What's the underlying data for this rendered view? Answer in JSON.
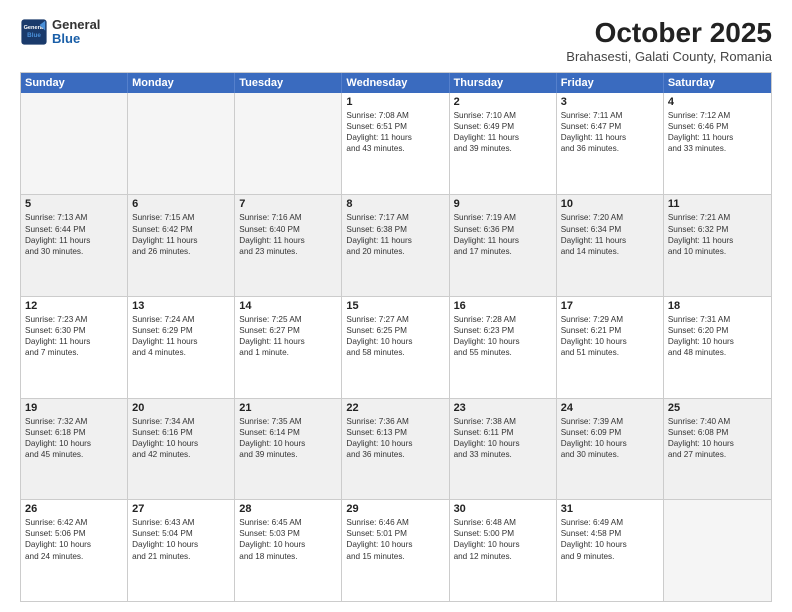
{
  "header": {
    "logo_general": "General",
    "logo_blue": "Blue",
    "title": "October 2025",
    "subtitle": "Brahasesti, Galati County, Romania"
  },
  "days_of_week": [
    "Sunday",
    "Monday",
    "Tuesday",
    "Wednesday",
    "Thursday",
    "Friday",
    "Saturday"
  ],
  "weeks": [
    [
      {
        "day": "",
        "empty": true
      },
      {
        "day": "",
        "empty": true
      },
      {
        "day": "",
        "empty": true
      },
      {
        "day": "1",
        "lines": [
          "Sunrise: 7:08 AM",
          "Sunset: 6:51 PM",
          "Daylight: 11 hours",
          "and 43 minutes."
        ]
      },
      {
        "day": "2",
        "lines": [
          "Sunrise: 7:10 AM",
          "Sunset: 6:49 PM",
          "Daylight: 11 hours",
          "and 39 minutes."
        ]
      },
      {
        "day": "3",
        "lines": [
          "Sunrise: 7:11 AM",
          "Sunset: 6:47 PM",
          "Daylight: 11 hours",
          "and 36 minutes."
        ]
      },
      {
        "day": "4",
        "lines": [
          "Sunrise: 7:12 AM",
          "Sunset: 6:46 PM",
          "Daylight: 11 hours",
          "and 33 minutes."
        ]
      }
    ],
    [
      {
        "day": "5",
        "lines": [
          "Sunrise: 7:13 AM",
          "Sunset: 6:44 PM",
          "Daylight: 11 hours",
          "and 30 minutes."
        ]
      },
      {
        "day": "6",
        "lines": [
          "Sunrise: 7:15 AM",
          "Sunset: 6:42 PM",
          "Daylight: 11 hours",
          "and 26 minutes."
        ]
      },
      {
        "day": "7",
        "lines": [
          "Sunrise: 7:16 AM",
          "Sunset: 6:40 PM",
          "Daylight: 11 hours",
          "and 23 minutes."
        ]
      },
      {
        "day": "8",
        "lines": [
          "Sunrise: 7:17 AM",
          "Sunset: 6:38 PM",
          "Daylight: 11 hours",
          "and 20 minutes."
        ]
      },
      {
        "day": "9",
        "lines": [
          "Sunrise: 7:19 AM",
          "Sunset: 6:36 PM",
          "Daylight: 11 hours",
          "and 17 minutes."
        ]
      },
      {
        "day": "10",
        "lines": [
          "Sunrise: 7:20 AM",
          "Sunset: 6:34 PM",
          "Daylight: 11 hours",
          "and 14 minutes."
        ]
      },
      {
        "day": "11",
        "lines": [
          "Sunrise: 7:21 AM",
          "Sunset: 6:32 PM",
          "Daylight: 11 hours",
          "and 10 minutes."
        ]
      }
    ],
    [
      {
        "day": "12",
        "lines": [
          "Sunrise: 7:23 AM",
          "Sunset: 6:30 PM",
          "Daylight: 11 hours",
          "and 7 minutes."
        ]
      },
      {
        "day": "13",
        "lines": [
          "Sunrise: 7:24 AM",
          "Sunset: 6:29 PM",
          "Daylight: 11 hours",
          "and 4 minutes."
        ]
      },
      {
        "day": "14",
        "lines": [
          "Sunrise: 7:25 AM",
          "Sunset: 6:27 PM",
          "Daylight: 11 hours",
          "and 1 minute."
        ]
      },
      {
        "day": "15",
        "lines": [
          "Sunrise: 7:27 AM",
          "Sunset: 6:25 PM",
          "Daylight: 10 hours",
          "and 58 minutes."
        ]
      },
      {
        "day": "16",
        "lines": [
          "Sunrise: 7:28 AM",
          "Sunset: 6:23 PM",
          "Daylight: 10 hours",
          "and 55 minutes."
        ]
      },
      {
        "day": "17",
        "lines": [
          "Sunrise: 7:29 AM",
          "Sunset: 6:21 PM",
          "Daylight: 10 hours",
          "and 51 minutes."
        ]
      },
      {
        "day": "18",
        "lines": [
          "Sunrise: 7:31 AM",
          "Sunset: 6:20 PM",
          "Daylight: 10 hours",
          "and 48 minutes."
        ]
      }
    ],
    [
      {
        "day": "19",
        "lines": [
          "Sunrise: 7:32 AM",
          "Sunset: 6:18 PM",
          "Daylight: 10 hours",
          "and 45 minutes."
        ]
      },
      {
        "day": "20",
        "lines": [
          "Sunrise: 7:34 AM",
          "Sunset: 6:16 PM",
          "Daylight: 10 hours",
          "and 42 minutes."
        ]
      },
      {
        "day": "21",
        "lines": [
          "Sunrise: 7:35 AM",
          "Sunset: 6:14 PM",
          "Daylight: 10 hours",
          "and 39 minutes."
        ]
      },
      {
        "day": "22",
        "lines": [
          "Sunrise: 7:36 AM",
          "Sunset: 6:13 PM",
          "Daylight: 10 hours",
          "and 36 minutes."
        ]
      },
      {
        "day": "23",
        "lines": [
          "Sunrise: 7:38 AM",
          "Sunset: 6:11 PM",
          "Daylight: 10 hours",
          "and 33 minutes."
        ]
      },
      {
        "day": "24",
        "lines": [
          "Sunrise: 7:39 AM",
          "Sunset: 6:09 PM",
          "Daylight: 10 hours",
          "and 30 minutes."
        ]
      },
      {
        "day": "25",
        "lines": [
          "Sunrise: 7:40 AM",
          "Sunset: 6:08 PM",
          "Daylight: 10 hours",
          "and 27 minutes."
        ]
      }
    ],
    [
      {
        "day": "26",
        "lines": [
          "Sunrise: 6:42 AM",
          "Sunset: 5:06 PM",
          "Daylight: 10 hours",
          "and 24 minutes."
        ]
      },
      {
        "day": "27",
        "lines": [
          "Sunrise: 6:43 AM",
          "Sunset: 5:04 PM",
          "Daylight: 10 hours",
          "and 21 minutes."
        ]
      },
      {
        "day": "28",
        "lines": [
          "Sunrise: 6:45 AM",
          "Sunset: 5:03 PM",
          "Daylight: 10 hours",
          "and 18 minutes."
        ]
      },
      {
        "day": "29",
        "lines": [
          "Sunrise: 6:46 AM",
          "Sunset: 5:01 PM",
          "Daylight: 10 hours",
          "and 15 minutes."
        ]
      },
      {
        "day": "30",
        "lines": [
          "Sunrise: 6:48 AM",
          "Sunset: 5:00 PM",
          "Daylight: 10 hours",
          "and 12 minutes."
        ]
      },
      {
        "day": "31",
        "lines": [
          "Sunrise: 6:49 AM",
          "Sunset: 4:58 PM",
          "Daylight: 10 hours",
          "and 9 minutes."
        ]
      },
      {
        "day": "",
        "empty": true
      }
    ]
  ]
}
